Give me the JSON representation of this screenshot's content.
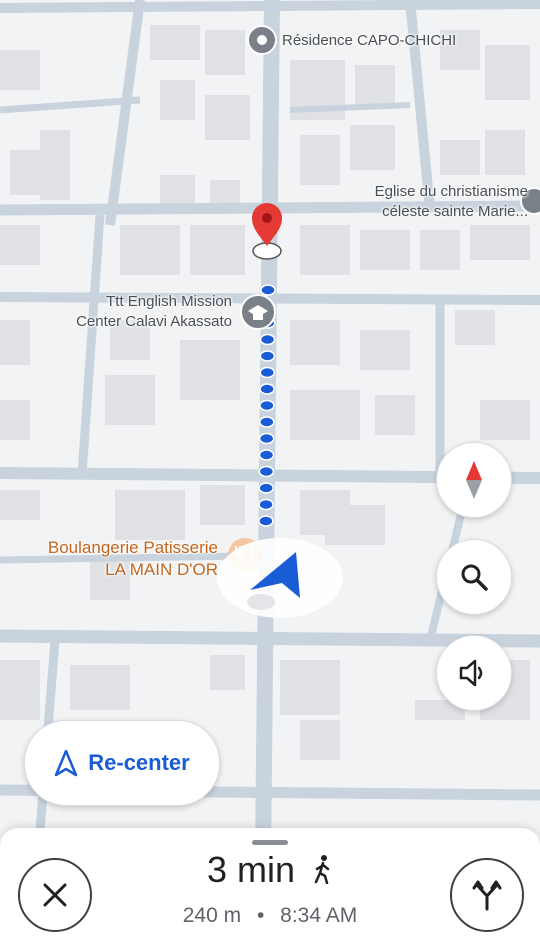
{
  "map": {
    "pois": [
      {
        "id": "residence",
        "label": "Résidence CAPO-CHICHI"
      },
      {
        "id": "eglise",
        "label_line1": "Eglise du christianisme",
        "label_line2": "céleste sainte Marie..."
      },
      {
        "id": "ttt",
        "label_line1": "Ttt English Mission",
        "label_line2": "Center Calavi Akassato"
      },
      {
        "id": "boulangerie",
        "label_line1": "Boulangerie Patisserie",
        "label_line2": "LA MAIN D'OR"
      }
    ],
    "route_color": "#1a5bd6",
    "destination_pin_color": "#e53935"
  },
  "controls": {
    "compass_icon": "compass-icon",
    "search_icon": "search-icon",
    "sound_icon": "speaker-icon",
    "recenter_label": "Re-center"
  },
  "bottom_sheet": {
    "eta_time": "3 min",
    "travel_mode": "walking-icon",
    "distance": "240 m",
    "separator": "•",
    "arrival_time": "8:34 AM",
    "close_icon": "close-icon",
    "alternate_routes_icon": "route-fork-icon"
  }
}
